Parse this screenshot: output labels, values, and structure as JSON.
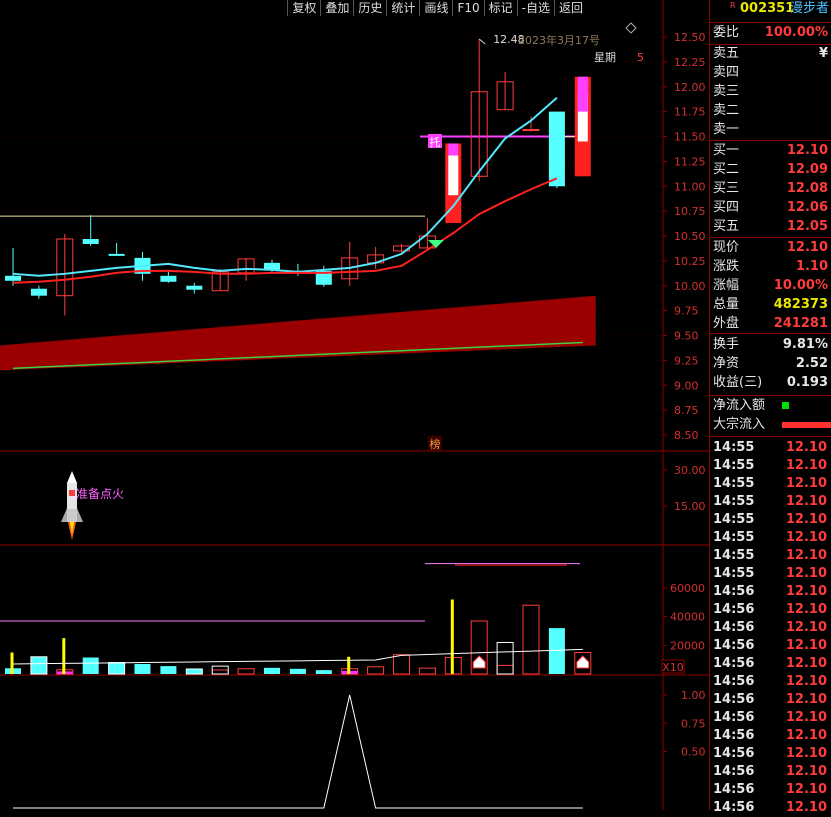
{
  "toolbar": [
    "复权",
    "叠加",
    "历史",
    "统计",
    "画线",
    "F10",
    "标记",
    "-自选",
    "返回"
  ],
  "main_chart": {
    "y_ticks": [
      "12.50",
      "12.25",
      "12.00",
      "11.75",
      "11.50",
      "11.25",
      "11.00",
      "10.75",
      "10.50",
      "10.25",
      "10.00",
      "9.75",
      "9.50",
      "9.25",
      "9.00",
      "8.75",
      "8.50"
    ],
    "high_label": "12.48",
    "date_label": "2023年3月17号",
    "weekday_label": "星期",
    "weekday_value": "5",
    "tag_tuo": "托",
    "tag_bang": "榜"
  },
  "indicator1": {
    "y_ticks": [
      "30.00",
      "15.00"
    ],
    "label": "准备点火"
  },
  "volume": {
    "y_ticks": [
      "60000",
      "40000",
      "20000"
    ],
    "unit": "X10"
  },
  "indicator3": {
    "y_ticks": [
      "1.00",
      "0.75",
      "0.50"
    ]
  },
  "right_panel": {
    "code_prefix": "R",
    "code": "002351",
    "name": "漫步者",
    "weibi_label": "委比",
    "weibi_value": "100.00%",
    "sell": [
      {
        "label": "卖五",
        "value": "¥"
      },
      {
        "label": "卖四",
        "value": ""
      },
      {
        "label": "卖三",
        "value": ""
      },
      {
        "label": "卖二",
        "value": ""
      },
      {
        "label": "卖一",
        "value": ""
      }
    ],
    "buy": [
      {
        "label": "买一",
        "value": "12.10"
      },
      {
        "label": "买二",
        "value": "12.09"
      },
      {
        "label": "买三",
        "value": "12.08"
      },
      {
        "label": "买四",
        "value": "12.06"
      },
      {
        "label": "买五",
        "value": "12.05"
      }
    ],
    "stats": [
      {
        "label": "现价",
        "value": "12.10",
        "color": "red"
      },
      {
        "label": "涨跌",
        "value": "1.10",
        "color": "red"
      },
      {
        "label": "涨幅",
        "value": "10.00%",
        "color": "red"
      },
      {
        "label": "总量",
        "value": "482373",
        "color": "yellow"
      },
      {
        "label": "外盘",
        "value": "241281",
        "color": "red"
      }
    ],
    "stats2": [
      {
        "label": "换手",
        "value": "9.81%",
        "color": "white"
      },
      {
        "label": "净资",
        "value": "2.52",
        "color": "white"
      },
      {
        "label": "收益(三)",
        "value": "0.193",
        "color": "white"
      }
    ],
    "flow": [
      {
        "label": "净流入额"
      },
      {
        "label": "大宗流入"
      }
    ],
    "trades": [
      {
        "time": "14:55",
        "price": "12.10"
      },
      {
        "time": "14:55",
        "price": "12.10"
      },
      {
        "time": "14:55",
        "price": "12.10"
      },
      {
        "time": "14:55",
        "price": "12.10"
      },
      {
        "time": "14:55",
        "price": "12.10"
      },
      {
        "time": "14:55",
        "price": "12.10"
      },
      {
        "time": "14:55",
        "price": "12.10"
      },
      {
        "time": "14:55",
        "price": "12.10"
      },
      {
        "time": "14:56",
        "price": "12.10"
      },
      {
        "time": "14:56",
        "price": "12.10"
      },
      {
        "time": "14:56",
        "price": "12.10"
      },
      {
        "time": "14:56",
        "price": "12.10"
      },
      {
        "time": "14:56",
        "price": "12.10"
      },
      {
        "time": "14:56",
        "price": "12.10"
      },
      {
        "time": "14:56",
        "price": "12.10"
      },
      {
        "time": "14:56",
        "price": "12.10"
      },
      {
        "time": "14:56",
        "price": "12.10"
      },
      {
        "time": "14:56",
        "price": "12.10"
      },
      {
        "time": "14:56",
        "price": "12.10"
      },
      {
        "time": "14:56",
        "price": "12.10"
      },
      {
        "time": "14:56",
        "price": "12.10"
      }
    ]
  },
  "chart_data": {
    "type": "candlestick",
    "y_range": [
      8.4,
      12.6
    ],
    "candles": [
      {
        "o": 10.1,
        "h": 10.38,
        "l": 10.0,
        "c": 10.05
      },
      {
        "o": 9.97,
        "h": 10.0,
        "l": 9.87,
        "c": 9.9
      },
      {
        "o": 9.9,
        "h": 10.52,
        "l": 9.7,
        "c": 10.47
      },
      {
        "o": 10.47,
        "h": 10.71,
        "l": 10.4,
        "c": 10.42
      },
      {
        "o": 10.32,
        "h": 10.43,
        "l": 10.3,
        "c": 10.3
      },
      {
        "o": 10.28,
        "h": 10.34,
        "l": 10.05,
        "c": 10.12
      },
      {
        "o": 10.1,
        "h": 10.14,
        "l": 10.03,
        "c": 10.04
      },
      {
        "o": 10.0,
        "h": 10.03,
        "l": 9.92,
        "c": 9.96
      },
      {
        "o": 9.95,
        "h": 10.17,
        "l": 9.95,
        "c": 10.14
      },
      {
        "o": 10.13,
        "h": 10.28,
        "l": 10.05,
        "c": 10.27
      },
      {
        "o": 10.23,
        "h": 10.26,
        "l": 10.14,
        "c": 10.16
      },
      {
        "o": 10.15,
        "h": 10.22,
        "l": 10.1,
        "c": 10.13
      },
      {
        "o": 10.15,
        "h": 10.2,
        "l": 9.99,
        "c": 10.01
      },
      {
        "o": 10.07,
        "h": 10.44,
        "l": 10.0,
        "c": 10.28
      },
      {
        "o": 10.23,
        "h": 10.39,
        "l": 10.17,
        "c": 10.31
      },
      {
        "o": 10.35,
        "h": 10.42,
        "l": 10.33,
        "c": 10.4
      },
      {
        "o": 10.38,
        "h": 10.68,
        "l": 10.35,
        "c": 10.5
      },
      {
        "o": 10.63,
        "h": 11.43,
        "l": 10.63,
        "c": 11.43
      },
      {
        "o": 11.1,
        "h": 12.48,
        "l": 11.05,
        "c": 11.95
      },
      {
        "o": 11.77,
        "h": 12.15,
        "l": 11.77,
        "c": 12.05
      },
      {
        "o": 11.57,
        "h": 11.7,
        "l": 11.55,
        "c": 11.57
      },
      {
        "o": 11.75,
        "h": 11.75,
        "l": 10.98,
        "c": 11.0
      },
      {
        "o": 11.1,
        "h": 12.1,
        "l": 11.1,
        "c": 12.1
      }
    ],
    "ma_short": [
      10.12,
      10.1,
      10.12,
      10.15,
      10.18,
      10.2,
      10.22,
      10.18,
      10.15,
      10.17,
      10.16,
      10.14,
      10.16,
      10.18,
      10.23,
      10.32,
      10.52,
      10.8,
      11.15,
      11.48,
      11.66,
      11.89
    ],
    "ma_long": [
      10.03,
      10.04,
      10.06,
      10.09,
      10.13,
      10.15,
      10.15,
      10.14,
      10.12,
      10.12,
      10.13,
      10.13,
      10.13,
      10.14,
      10.15,
      10.2,
      10.36,
      10.53,
      10.72,
      10.85,
      10.97,
      11.08
    ],
    "volume": [
      4000,
      12000,
      3000,
      11500,
      8000,
      7000,
      5500,
      3500,
      2800,
      3700,
      4300,
      3600,
      2700,
      3700,
      5000,
      13500,
      4100,
      11500,
      37000,
      6000,
      48000,
      32000,
      15000,
      22000
    ],
    "indicator3": [
      0,
      0,
      0,
      0,
      0,
      0,
      0,
      0,
      0,
      0,
      0,
      0,
      0,
      1.0,
      0,
      0,
      0,
      0,
      0,
      0,
      0,
      0,
      0,
      0
    ]
  }
}
